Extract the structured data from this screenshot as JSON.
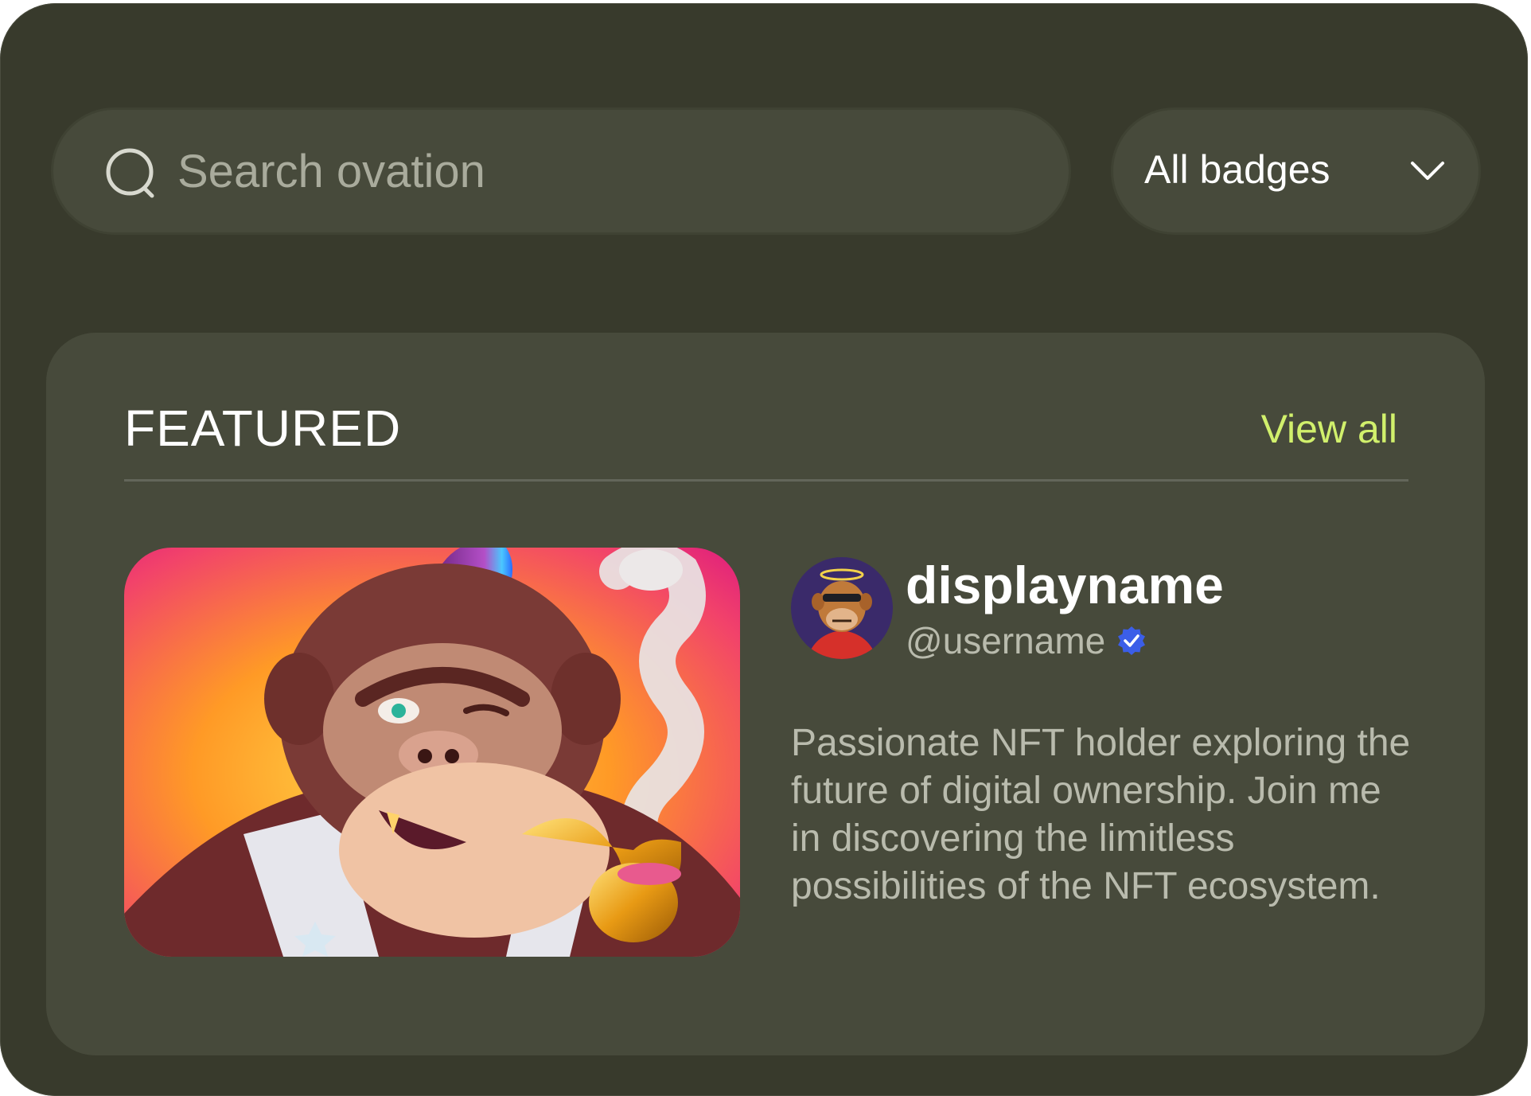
{
  "search": {
    "placeholder": "Search ovation",
    "icon": "search-icon"
  },
  "filter": {
    "selected": "All badges",
    "icon": "chevron-down-icon"
  },
  "featured": {
    "title": "FEATURED",
    "view_all_label": "View all",
    "accent_color": "#d1f06c",
    "profile": {
      "display_name": "displayname",
      "username": "@username",
      "verified": true,
      "verified_color": "#3b5ee8",
      "bio": "Passionate NFT holder exploring the future of digital ownership. Join me in discovering the limitless possibilities of the NFT ecosystem."
    }
  },
  "colors": {
    "background": "#383a2c",
    "surface": "#474a3b"
  }
}
